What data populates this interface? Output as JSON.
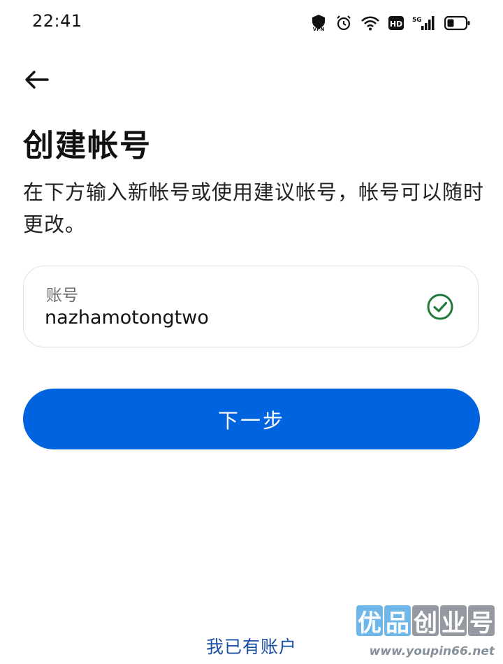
{
  "status_bar": {
    "time": "22:41",
    "icons": [
      "vpn-icon",
      "alarm-icon",
      "wifi-icon",
      "hd-icon",
      "5g-signal-icon",
      "battery-icon"
    ],
    "vpn_label": "VPN",
    "hd_label": "HD",
    "network_label": "5G"
  },
  "header": {
    "back_icon": "arrow-left-icon",
    "title": "创建帐号",
    "description": "在下方输入新帐号或使用建议帐号，帐号可以随时更改。"
  },
  "account_field": {
    "label": "账号",
    "value": "nazhamotongtwo",
    "status_icon": "check-circle-icon",
    "status_color": "#1f7a3a"
  },
  "actions": {
    "next_label": "下一步",
    "next_color": "#0064e0",
    "existing_account_label": "我已有账户",
    "link_color": "#1a4fa6"
  },
  "watermark": {
    "logo_chars": [
      "优",
      "品",
      "创",
      "业",
      "号"
    ],
    "url": "www.youpin66.net"
  }
}
